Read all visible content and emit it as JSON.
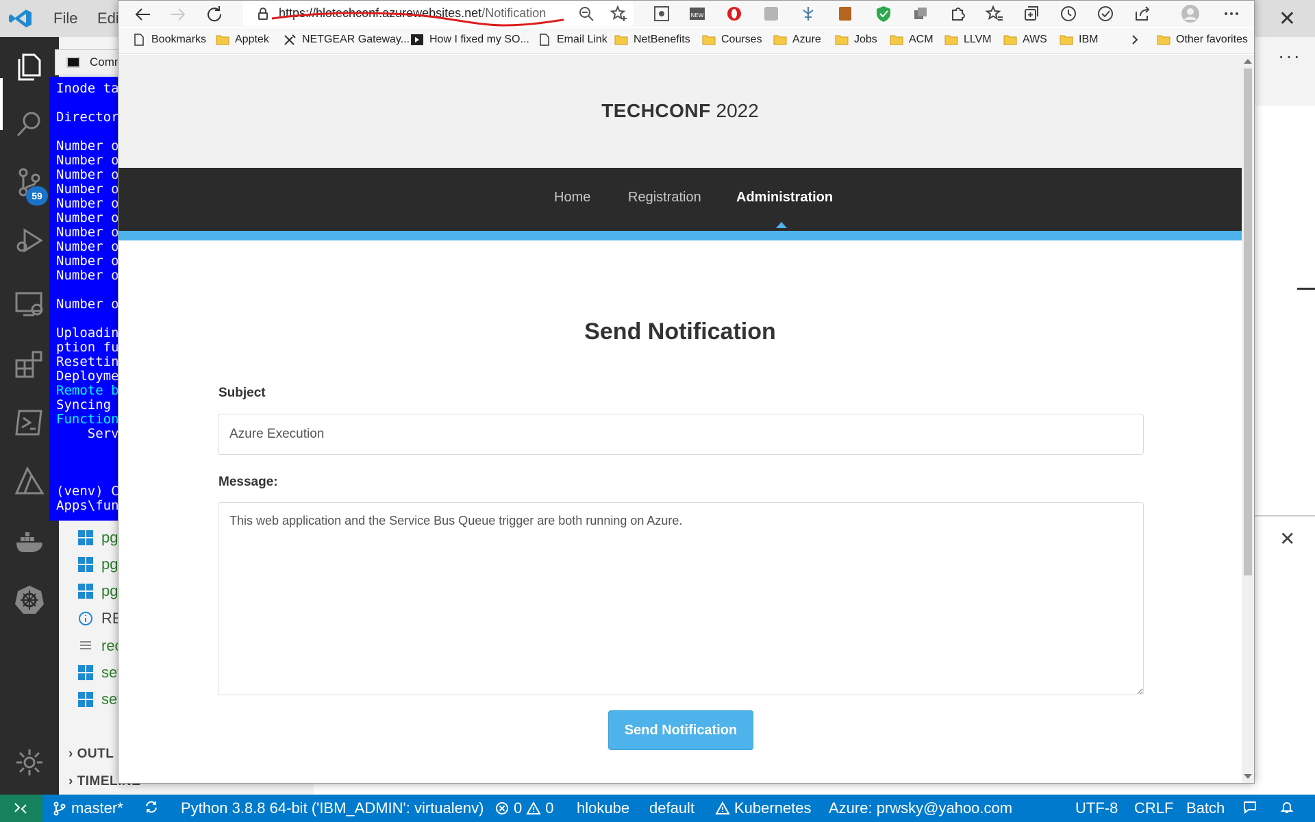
{
  "vscode": {
    "menu": [
      "File",
      "Edi"
    ],
    "scm_badge": "59",
    "explorer_files": [
      "pg",
      "pg",
      "pg",
      "RE",
      "rec",
      "set",
      "set"
    ],
    "sections": [
      "OUTL",
      "TIMELINE"
    ]
  },
  "cmd": {
    "tab_title": "Comm",
    "lines": [
      "Inode ta",
      "Director",
      "Number o",
      "Number o",
      "Number o",
      "Number o",
      "Number o",
      "Number o",
      "Number o",
      "Number o",
      "Number o",
      "Number o",
      "Number o",
      "Uploadin",
      "ption fu",
      "Resettin",
      "Deployme",
      "Remote b",
      "Syncing ",
      "Function",
      "    Serv",
      "(venv) C",
      "Apps\\fun"
    ]
  },
  "browser": {
    "url_host": "https://hlotechconf.azurewebsites.net",
    "url_path": "/Notification",
    "bookmarks": [
      "Bookmarks",
      "Apptek",
      "NETGEAR Gateway...",
      "How I fixed my SO...",
      "Email Link",
      "NetBenefits",
      "Courses",
      "Azure",
      "Jobs",
      "ACM",
      "LLVM",
      "AWS",
      "IBM",
      "Other favorites"
    ],
    "ext_label": "NEW"
  },
  "site": {
    "brand": "TECHCONF",
    "year": "2022",
    "nav": [
      "Home",
      "Registration",
      "Administration"
    ],
    "active_nav": "Administration"
  },
  "form": {
    "title": "Send Notification",
    "subject_label": "Subject",
    "subject_value": "Azure Execution",
    "message_label": "Message:",
    "message_value": "This web application and the Service Bus Queue trigger are both running on Azure.",
    "submit_label": "Send Notification"
  },
  "status": {
    "branch": "master*",
    "python": "Python 3.8.8 64-bit ('IBM_ADMIN': virtualenv)",
    "errors": "0",
    "warnings": "0",
    "k8s_context": "hlokube",
    "namespace": "default",
    "kubernetes": "Kubernetes",
    "azure": "Azure: prwsky@yahoo.com",
    "encoding": "UTF-8",
    "eol": "CRLF",
    "language": "Batch"
  },
  "colors": {
    "accent": "#4eb3ea",
    "nav_bg": "#2b2b2b",
    "statusbar": "#007acc",
    "cmd_bg": "#0000ff"
  }
}
